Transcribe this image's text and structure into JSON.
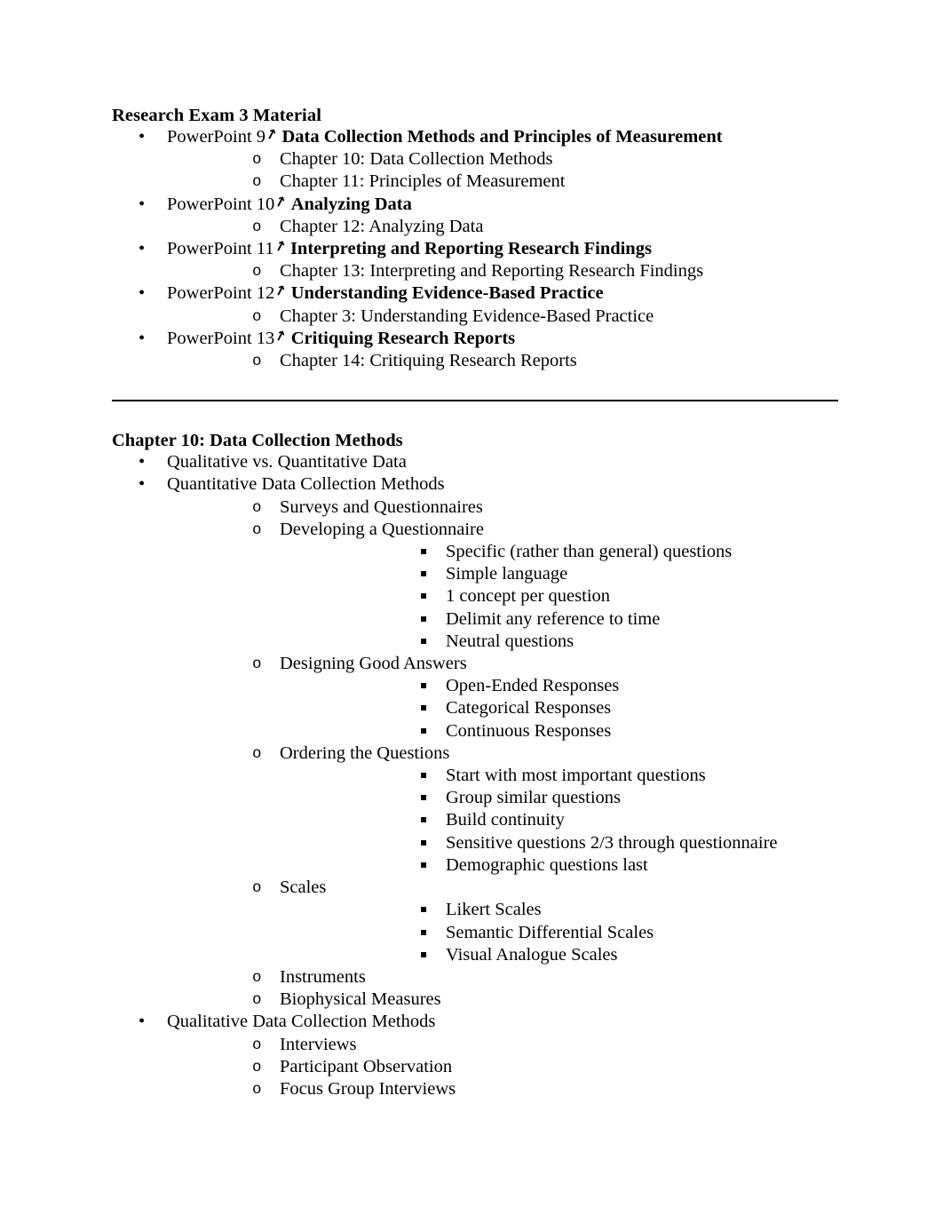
{
  "document": {
    "title": "Research Exam 3 Material",
    "arrow_glyph": "arrow-right-icon"
  },
  "section1": {
    "heading": "Research Exam 3 Material",
    "items": [
      {
        "prefix": "PowerPoint 9",
        "arrow": "↗",
        "bold_text": "Data Collection Methods and Principles of Measurement",
        "children": [
          "Chapter 10: Data Collection Methods",
          "Chapter 11: Principles of Measurement"
        ]
      },
      {
        "prefix": "PowerPoint 10",
        "arrow": "↗",
        "bold_text": "Analyzing Data",
        "children": [
          "Chapter 12: Analyzing Data"
        ]
      },
      {
        "prefix": "PowerPoint 11",
        "arrow": "↗",
        "bold_text": "Interpreting and Reporting Research Findings",
        "children": [
          "Chapter 13: Interpreting and Reporting Research Findings"
        ]
      },
      {
        "prefix": "PowerPoint 12",
        "arrow": "↗",
        "bold_text": "Understanding Evidence-Based Practice",
        "children": [
          "Chapter 3: Understanding Evidence-Based Practice"
        ]
      },
      {
        "prefix": "PowerPoint 13",
        "arrow": "↗",
        "bold_text": "Critiquing Research Reports",
        "children": [
          "Chapter 14: Critiquing Research Reports"
        ]
      }
    ]
  },
  "section2": {
    "heading": "Chapter 10: Data Collection Methods",
    "items": [
      {
        "label": "Qualitative vs. Quantitative Data",
        "children": []
      },
      {
        "label": "Quantitative Data Collection Methods",
        "children": [
          {
            "label": "Surveys and Questionnaires",
            "children": []
          },
          {
            "label": "Developing a Questionnaire",
            "children": [
              "Specific (rather than general) questions",
              "Simple language",
              "1 concept per question",
              "Delimit any reference to time",
              "Neutral questions"
            ]
          },
          {
            "label": "Designing Good Answers",
            "children": [
              "Open-Ended Responses",
              "Categorical Responses",
              "Continuous Responses"
            ]
          },
          {
            "label": "Ordering the Questions",
            "children": [
              "Start with most important questions",
              "Group similar questions",
              "Build continuity",
              "Sensitive questions 2/3 through questionnaire",
              "Demographic questions last"
            ]
          },
          {
            "label": "Scales",
            "children": [
              "Likert Scales",
              "Semantic Differential Scales",
              "Visual Analogue Scales"
            ]
          },
          {
            "label": "Instruments",
            "children": []
          },
          {
            "label": "Biophysical Measures",
            "children": []
          }
        ]
      },
      {
        "label": "Qualitative Data Collection Methods",
        "children": [
          {
            "label": "Interviews",
            "children": []
          },
          {
            "label": "Participant Observation",
            "children": []
          },
          {
            "label": "Focus Group Interviews",
            "children": []
          }
        ]
      }
    ]
  }
}
